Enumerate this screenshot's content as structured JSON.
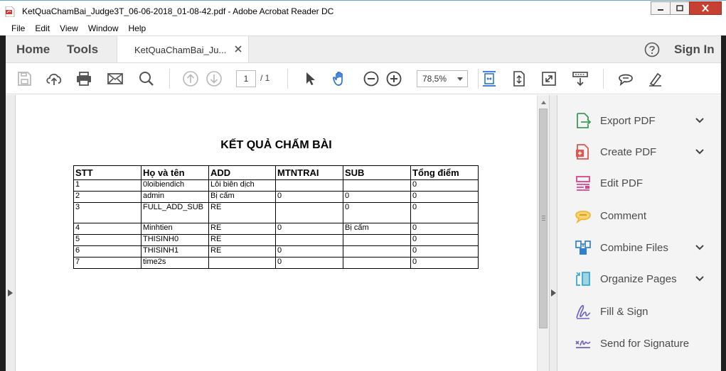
{
  "window": {
    "title": "KetQuaChamBai_Judge3T_06-06-2018_01-08-42.pdf - Adobe Acrobat Reader DC"
  },
  "menu": [
    "File",
    "Edit",
    "View",
    "Window",
    "Help"
  ],
  "tabs": {
    "home": "Home",
    "tools": "Tools",
    "document": "KetQuaChamBai_Ju...",
    "sign_in": "Sign In"
  },
  "toolbar": {
    "page_current": "1",
    "page_total": "/ 1",
    "zoom": "78,5%"
  },
  "document": {
    "heading": "KẾT QUẢ CHẤM BÀI",
    "columns": [
      "STT",
      "Họ và tên",
      "ADD",
      "MTNTRAI",
      "SUB",
      "Tổng điểm"
    ],
    "rows": [
      [
        "1",
        "0loibiendich",
        "Lỗi biên dịch",
        "",
        "",
        "0"
      ],
      [
        "2",
        "admin",
        "Bị cấm",
        "0",
        "0",
        "0"
      ],
      [
        "3",
        "FULL_ADD_SUB",
        "RE",
        "",
        "0",
        "0"
      ],
      [
        "4",
        "Minhtien",
        "RE",
        "0",
        "Bị cấm",
        "0"
      ],
      [
        "5",
        "THISINH0",
        "RE",
        "",
        "",
        "0"
      ],
      [
        "6",
        "THISINH1",
        "RE",
        "0",
        "",
        "0"
      ],
      [
        "7",
        "time2s",
        "",
        "0",
        "",
        "0"
      ]
    ]
  },
  "tools_pane": [
    {
      "label": "Export PDF",
      "icon": "export-pdf-icon",
      "expandable": true,
      "color": "#3f9a5b"
    },
    {
      "label": "Create PDF",
      "icon": "create-pdf-icon",
      "expandable": true,
      "color": "#e0574f"
    },
    {
      "label": "Edit PDF",
      "icon": "edit-pdf-icon",
      "expandable": false,
      "color": "#d9458b"
    },
    {
      "label": "Comment",
      "icon": "comment-icon",
      "expandable": false,
      "color": "#f0b429"
    },
    {
      "label": "Combine Files",
      "icon": "combine-files-icon",
      "expandable": true,
      "color": "#2f7fd1"
    },
    {
      "label": "Organize Pages",
      "icon": "organize-pages-icon",
      "expandable": true,
      "color": "#31a6c9"
    },
    {
      "label": "Fill & Sign",
      "icon": "fill-sign-icon",
      "expandable": false,
      "color": "#6f62c6"
    },
    {
      "label": "Send for Signature",
      "icon": "send-signature-icon",
      "expandable": false,
      "color": "#6f62c6"
    }
  ],
  "colors": {
    "accent": "#2c73d2",
    "pane_bg": "#f4f4f4",
    "tab_bar_bg": "#eeeeee",
    "close_button": "#c84031"
  }
}
